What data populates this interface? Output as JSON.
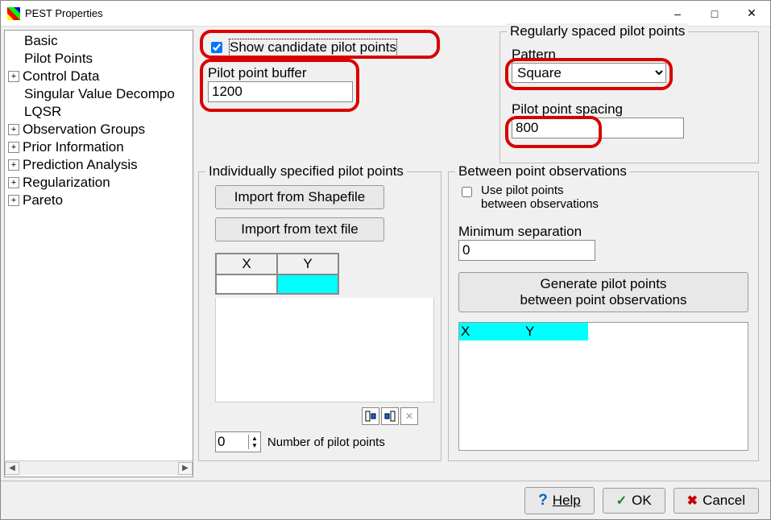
{
  "window": {
    "title": "PEST Properties"
  },
  "tree": {
    "items": [
      {
        "label": "Basic",
        "expandable": false
      },
      {
        "label": "Pilot Points",
        "expandable": false
      },
      {
        "label": "Control Data",
        "expandable": true
      },
      {
        "label": "Singular Value Decomposition",
        "expandable": false,
        "truncated": "Singular Value Decompo"
      },
      {
        "label": "LQSR",
        "expandable": false
      },
      {
        "label": "Observation Groups",
        "expandable": true
      },
      {
        "label": "Prior Information",
        "expandable": true
      },
      {
        "label": "Prediction Analysis",
        "expandable": true
      },
      {
        "label": "Regularization",
        "expandable": true
      },
      {
        "label": "Pareto",
        "expandable": true
      }
    ]
  },
  "top": {
    "show_candidate_label": "Show candidate pilot points",
    "show_candidate_checked": true,
    "buffer_label": "Pilot point buffer",
    "buffer_value": "1200"
  },
  "regular": {
    "legend": "Regularly spaced pilot points",
    "pattern_label": "Pattern",
    "pattern_value": "Square",
    "spacing_label": "Pilot point spacing",
    "spacing_value": "800"
  },
  "individual": {
    "legend": "Individually specified pilot points",
    "import_shape": "Import from Shapefile",
    "import_text": "Import from text file",
    "col_x": "X",
    "col_y": "Y",
    "count_value": "0",
    "count_label": "Number of pilot points"
  },
  "between": {
    "legend": "Between point observations",
    "use_label_1": "Use pilot points",
    "use_label_2": "between observations",
    "use_checked": false,
    "min_sep_label": "Minimum separation",
    "min_sep_value": "0",
    "gen_button_1": "Generate pilot points",
    "gen_button_2": "between point observations",
    "col_x": "X",
    "col_y": "Y"
  },
  "footer": {
    "help": "Help",
    "ok": "OK",
    "cancel": "Cancel"
  }
}
